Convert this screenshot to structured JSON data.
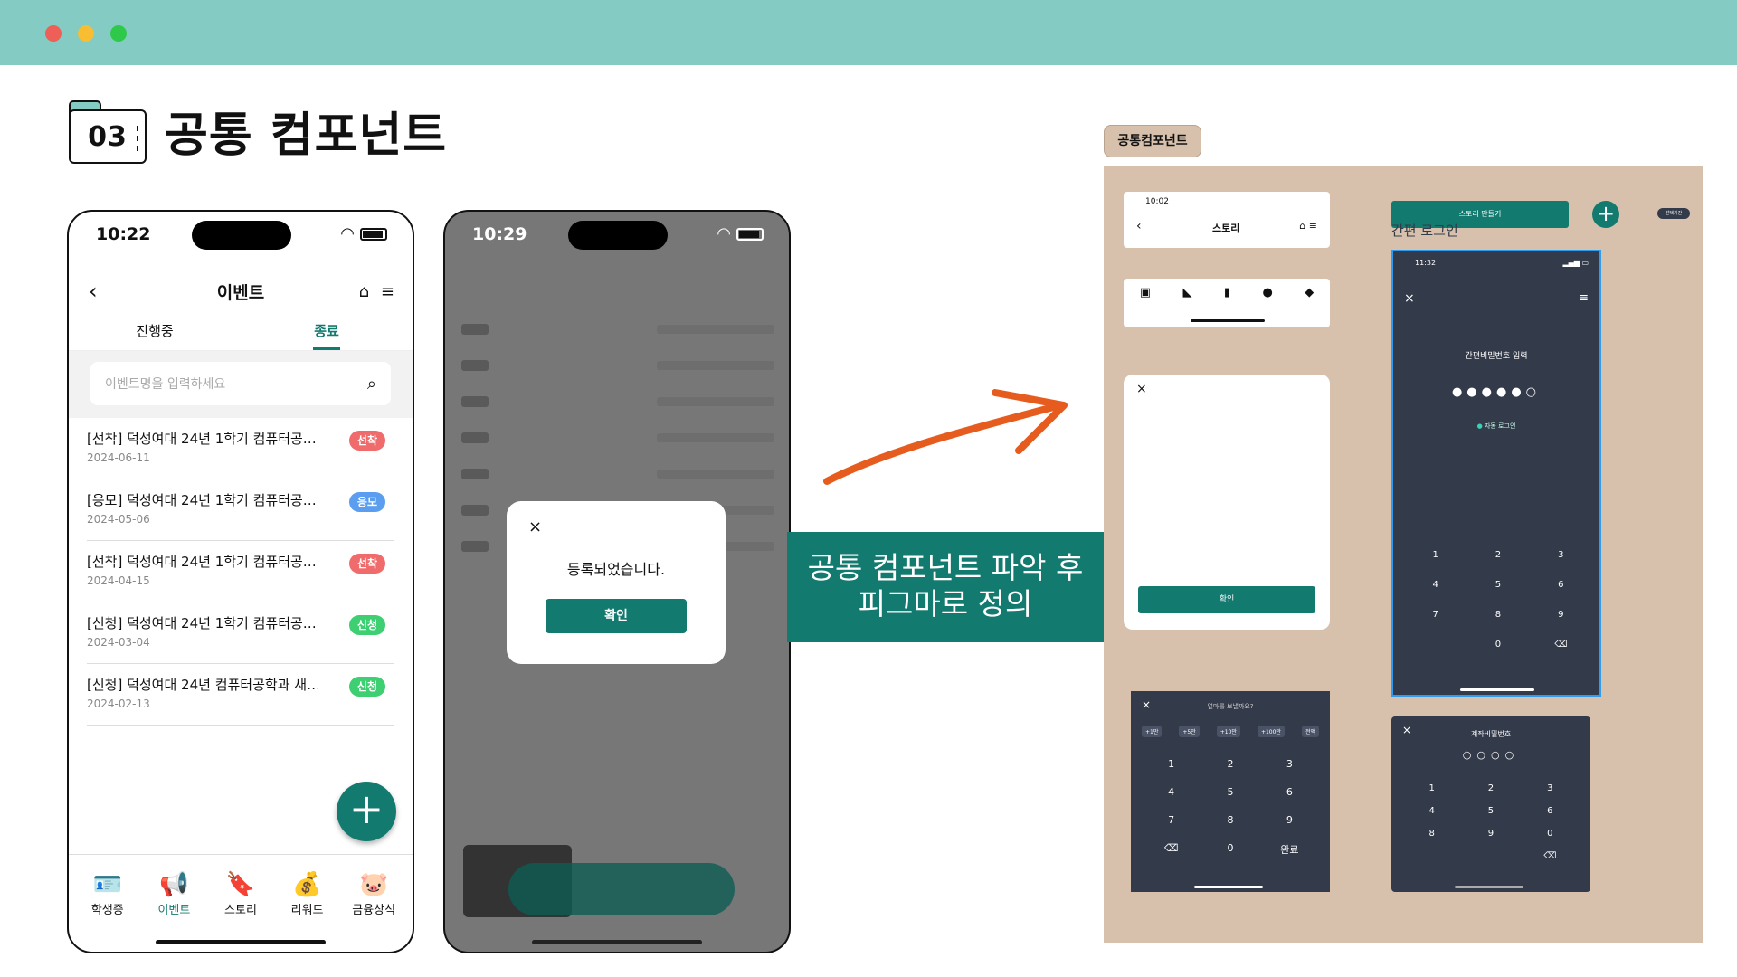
{
  "window": {
    "dots": [
      "#ee5f57",
      "#f8bd31",
      "#2ec94a"
    ]
  },
  "section": {
    "number": "03",
    "title": "공통 컴포넌트"
  },
  "phone1": {
    "time": "10:22",
    "title": "이벤트",
    "tabs": [
      "진행중",
      "종료"
    ],
    "search_placeholder": "이벤트명을 입력하세요",
    "events": [
      {
        "title": "[선착] 덕성여대 24년 1학기 컴퓨터공…",
        "date": "2024-06-11",
        "badge": "선착",
        "color": "#f06b6b"
      },
      {
        "title": "[응모] 덕성여대 24년 1학기 컴퓨터공…",
        "date": "2024-05-06",
        "badge": "응모",
        "color": "#5b9ef0"
      },
      {
        "title": "[선착] 덕성여대 24년 1학기 컴퓨터공…",
        "date": "2024-04-15",
        "badge": "선착",
        "color": "#f06b6b"
      },
      {
        "title": "[신청] 덕성여대 24년 1학기 컴퓨터공…",
        "date": "2024-03-04",
        "badge": "신청",
        "color": "#3ecf73"
      },
      {
        "title": "[신청] 덕성여대 24년 컴퓨터공학과 새…",
        "date": "2024-02-13",
        "badge": "신청",
        "color": "#3ecf73"
      }
    ],
    "nav": [
      {
        "label": "학생증",
        "icon": "id-card-icon",
        "glyph": "🪪"
      },
      {
        "label": "이벤트",
        "icon": "megaphone-icon",
        "glyph": "📢"
      },
      {
        "label": "스토리",
        "icon": "bookmark-icon",
        "glyph": "🔖"
      },
      {
        "label": "리워드",
        "icon": "reward-icon",
        "glyph": "💰"
      },
      {
        "label": "금융상식",
        "icon": "piggy-bank-icon",
        "glyph": "🐷"
      }
    ]
  },
  "phone2": {
    "time": "10:29",
    "dialog_message": "등록되었습니다.",
    "dialog_button": "확인"
  },
  "callout": {
    "line1": "공통 컴포넌트 파악 후",
    "line2": "피그마로 정의"
  },
  "figma": {
    "tag": "공통컴포넌트",
    "header_time": "10:02",
    "header_title": "스토리",
    "modal_button": "확인",
    "story_button": "스토리 만들기",
    "pill": "선택기간",
    "frame_label": "간편 로그인",
    "login_time": "11:32",
    "login_title": "간편비밀번호 입력",
    "login_auto": "자동 로그인",
    "amount_title": "얼마를 보낼까요?",
    "amount_chips": [
      "+1만",
      "+5만",
      "+10만",
      "+100만",
      "전액"
    ],
    "keypad_done": "완료",
    "account_title": "계좌비밀번호"
  }
}
